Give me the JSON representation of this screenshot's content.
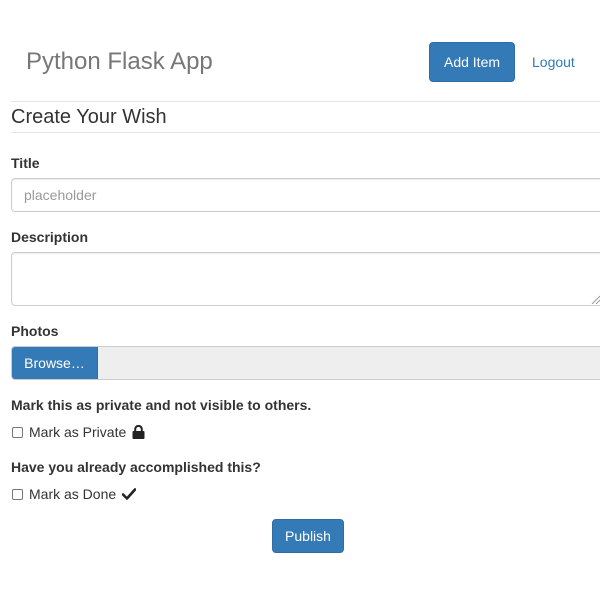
{
  "header": {
    "brand": "Python Flask App",
    "nav": {
      "add_item": "Add Item",
      "logout": "Logout"
    }
  },
  "form": {
    "heading": "Create Your Wish",
    "title": {
      "label": "Title",
      "value": "",
      "placeholder": "placeholder"
    },
    "description": {
      "label": "Description",
      "value": ""
    },
    "photos": {
      "label": "Photos",
      "browse_label": "Browse…"
    },
    "private": {
      "prompt": "Mark this as private and not visible to others.",
      "checkbox_label": "Mark as Private",
      "checked": false,
      "icon": "lock-icon"
    },
    "done": {
      "prompt": "Have you already accomplished this?",
      "checkbox_label": "Mark as Done",
      "checked": false,
      "icon": "checkmark-icon"
    },
    "submit_label": "Publish"
  },
  "colors": {
    "primary": "#337ab7",
    "primary_border": "#2e6da4",
    "brand_text": "#777777",
    "text": "#333333",
    "file_bg": "#eeeeee"
  }
}
